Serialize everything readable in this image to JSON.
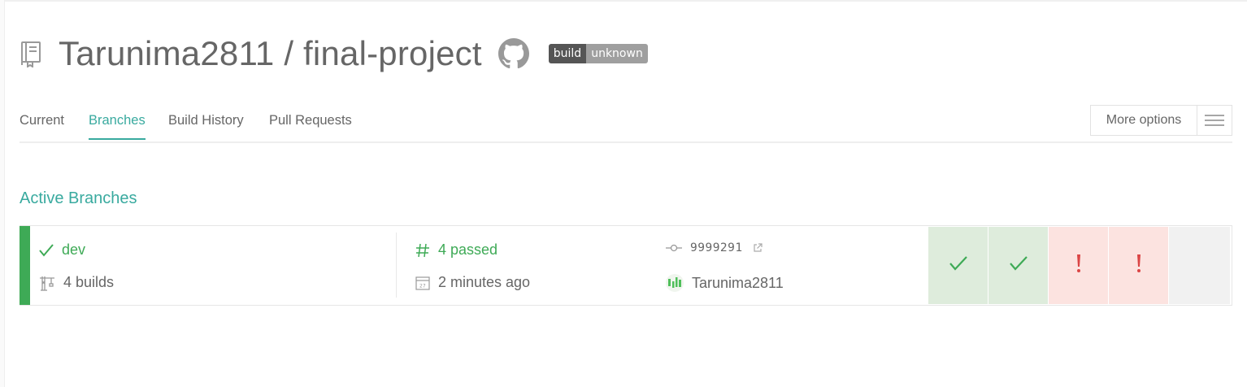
{
  "repo": {
    "title": "Tarunima2811 / final-project",
    "repo_icon": "repo-book-icon",
    "github_icon": "github-icon",
    "badge": {
      "left": "build",
      "right": "unknown"
    }
  },
  "tabs": [
    {
      "label": "Current",
      "active": false
    },
    {
      "label": "Branches",
      "active": true
    },
    {
      "label": "Build History",
      "active": false
    },
    {
      "label": "Pull Requests",
      "active": false
    }
  ],
  "more_options": {
    "label": "More options",
    "icon": "hamburger-icon"
  },
  "section": {
    "title": "Active Branches"
  },
  "branch": {
    "name": "dev",
    "builds": "4 builds",
    "build_status": "4 passed",
    "time": "2 minutes ago",
    "commit": "9999291",
    "author": "Tarunima2811",
    "status_color": "#3eaa56",
    "history": [
      {
        "state": "passed",
        "icon": "check-icon"
      },
      {
        "state": "passed",
        "icon": "check-icon"
      },
      {
        "state": "failed",
        "icon": "exclamation-icon"
      },
      {
        "state": "failed",
        "icon": "exclamation-icon"
      },
      {
        "state": "empty",
        "icon": ""
      }
    ]
  },
  "colors": {
    "accent": "#39aa9f",
    "passed": "#3eaa56",
    "failed": "#db4545",
    "passed_bg": "#deecdc",
    "failed_bg": "#fce3e0"
  }
}
